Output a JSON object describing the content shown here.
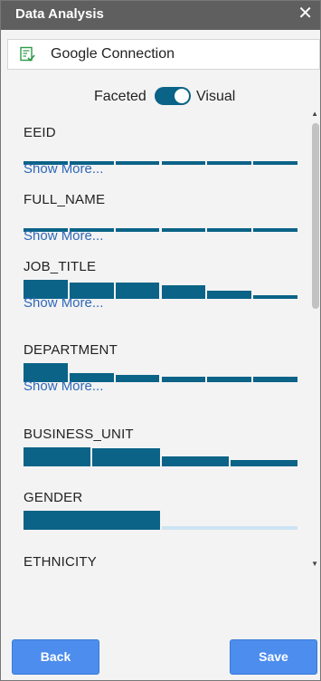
{
  "window": {
    "title": "Data Analysis",
    "close_icon": "close-icon"
  },
  "connection": {
    "label": "Google Connection",
    "icon": "sheet-check-icon"
  },
  "view_toggle": {
    "left_label": "Faceted",
    "right_label": "Visual",
    "selected": "Visual"
  },
  "fields": [
    {
      "name": "EEID",
      "show_more": "Show More...",
      "bars": [
        0.1,
        0.1,
        0.1,
        0.1,
        0.1,
        0.1
      ]
    },
    {
      "name": "FULL_NAME",
      "show_more": "Show More...",
      "bars": [
        0.1,
        0.1,
        0.1,
        0.1,
        0.1,
        0.1
      ]
    },
    {
      "name": "JOB_TITLE",
      "show_more": "Show More...",
      "bars": [
        0.95,
        0.8,
        0.8,
        0.7,
        0.4,
        0.2
      ]
    },
    {
      "name": "DEPARTMENT",
      "show_more": "Show More...",
      "bars": [
        0.95,
        0.45,
        0.35,
        0.25,
        0.25,
        0.25
      ]
    },
    {
      "name": "BUSINESS_UNIT",
      "show_more": "",
      "bars": [
        0.95,
        0.9,
        0.5,
        0.3
      ]
    },
    {
      "name": "GENDER",
      "show_more": "",
      "bars": [
        0.95,
        0.2
      ],
      "light_last": true
    },
    {
      "name": "ETHNICITY",
      "show_more": "",
      "bars": []
    }
  ],
  "footer": {
    "back_label": "Back",
    "save_label": "Save"
  },
  "colors": {
    "accent": "#0b6387",
    "button": "#4c8ded",
    "link": "#2f68b8",
    "light_bar": "#cde3f3"
  }
}
